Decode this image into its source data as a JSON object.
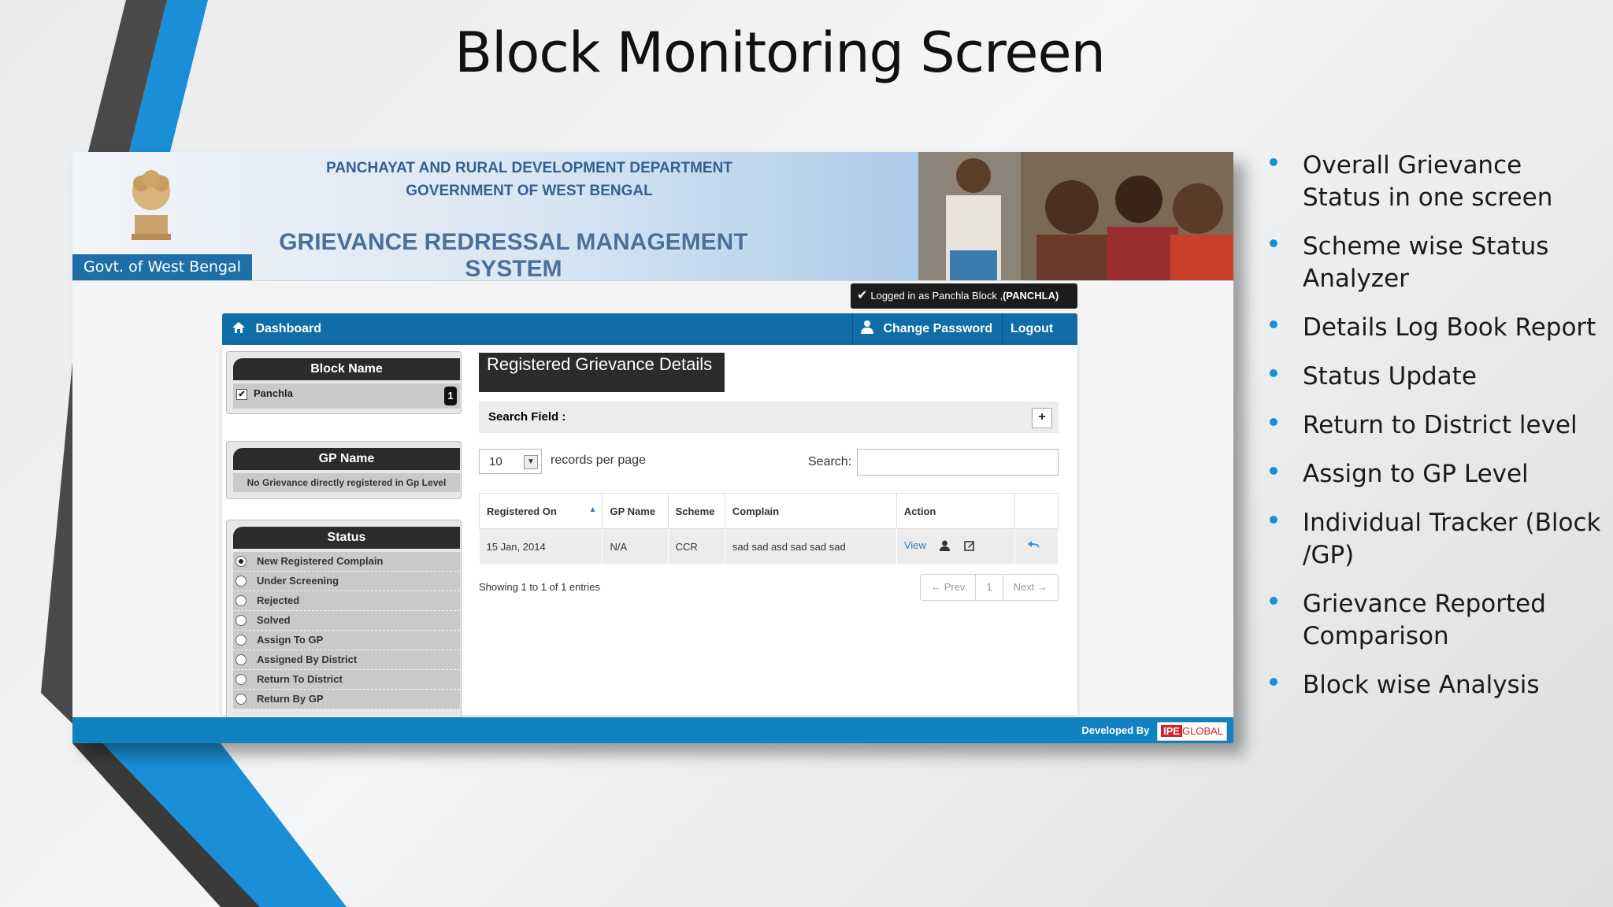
{
  "slide": {
    "title": "Block Monitoring Screen",
    "bullets": [
      "Overall Grievance Status in one screen",
      "Scheme wise Status Analyzer",
      "Details Log Book Report",
      "Status Update",
      "Return to District level",
      "Assign to GP Level",
      "Individual Tracker (Block /GP)",
      "Grievance Reported Comparison",
      "Block wise Analysis"
    ]
  },
  "header": {
    "govt_label": "Govt. of West Bengal",
    "dept_line1": "PANCHAYAT AND RURAL DEVELOPMENT DEPARTMENT",
    "dept_line2": "GOVERNMENT OF WEST BENGAL",
    "system_name": "GRIEVANCE REDRESSAL MANAGEMENT SYSTEM"
  },
  "login": {
    "text_prefix": "Logged in as Panchla Block ,",
    "user": "(PANCHLA)"
  },
  "nav": {
    "dashboard": "Dashboard",
    "change_password": "Change Password",
    "logout": "Logout"
  },
  "sidebar": {
    "block_heading": "Block Name",
    "block_item": "Panchla",
    "block_count": "1",
    "gp_heading": "GP Name",
    "gp_note": "No Grievance directly registered in Gp Level",
    "status_heading": "Status",
    "statuses": [
      "New Registered Complain",
      "Under Screening",
      "Rejected",
      "Solved",
      "Assign To GP",
      "Assigned By District",
      "Return To District",
      "Return By GP"
    ]
  },
  "main": {
    "title": "Registered Grievance Details",
    "search_field_label": "Search Field :",
    "plus": "+",
    "page_size": "10",
    "records_per_page": "records per page",
    "search_label": "Search:",
    "columns": [
      "Registered On",
      "GP Name",
      "Scheme",
      "Complain",
      "Action"
    ],
    "rows": [
      {
        "registered_on": "15 Jan, 2014",
        "gp_name": "N/A",
        "scheme": "CCR",
        "complain": "sad sad asd sad sad sad",
        "action": "View"
      }
    ],
    "showing": "Showing 1 to 1 of 1 entries",
    "pager": {
      "prev": "← Prev",
      "page": "1",
      "next": "Next →"
    }
  },
  "footer": {
    "developed_by": "Developed By",
    "logo_a": "IPE",
    "logo_b": "GLOBAL"
  }
}
